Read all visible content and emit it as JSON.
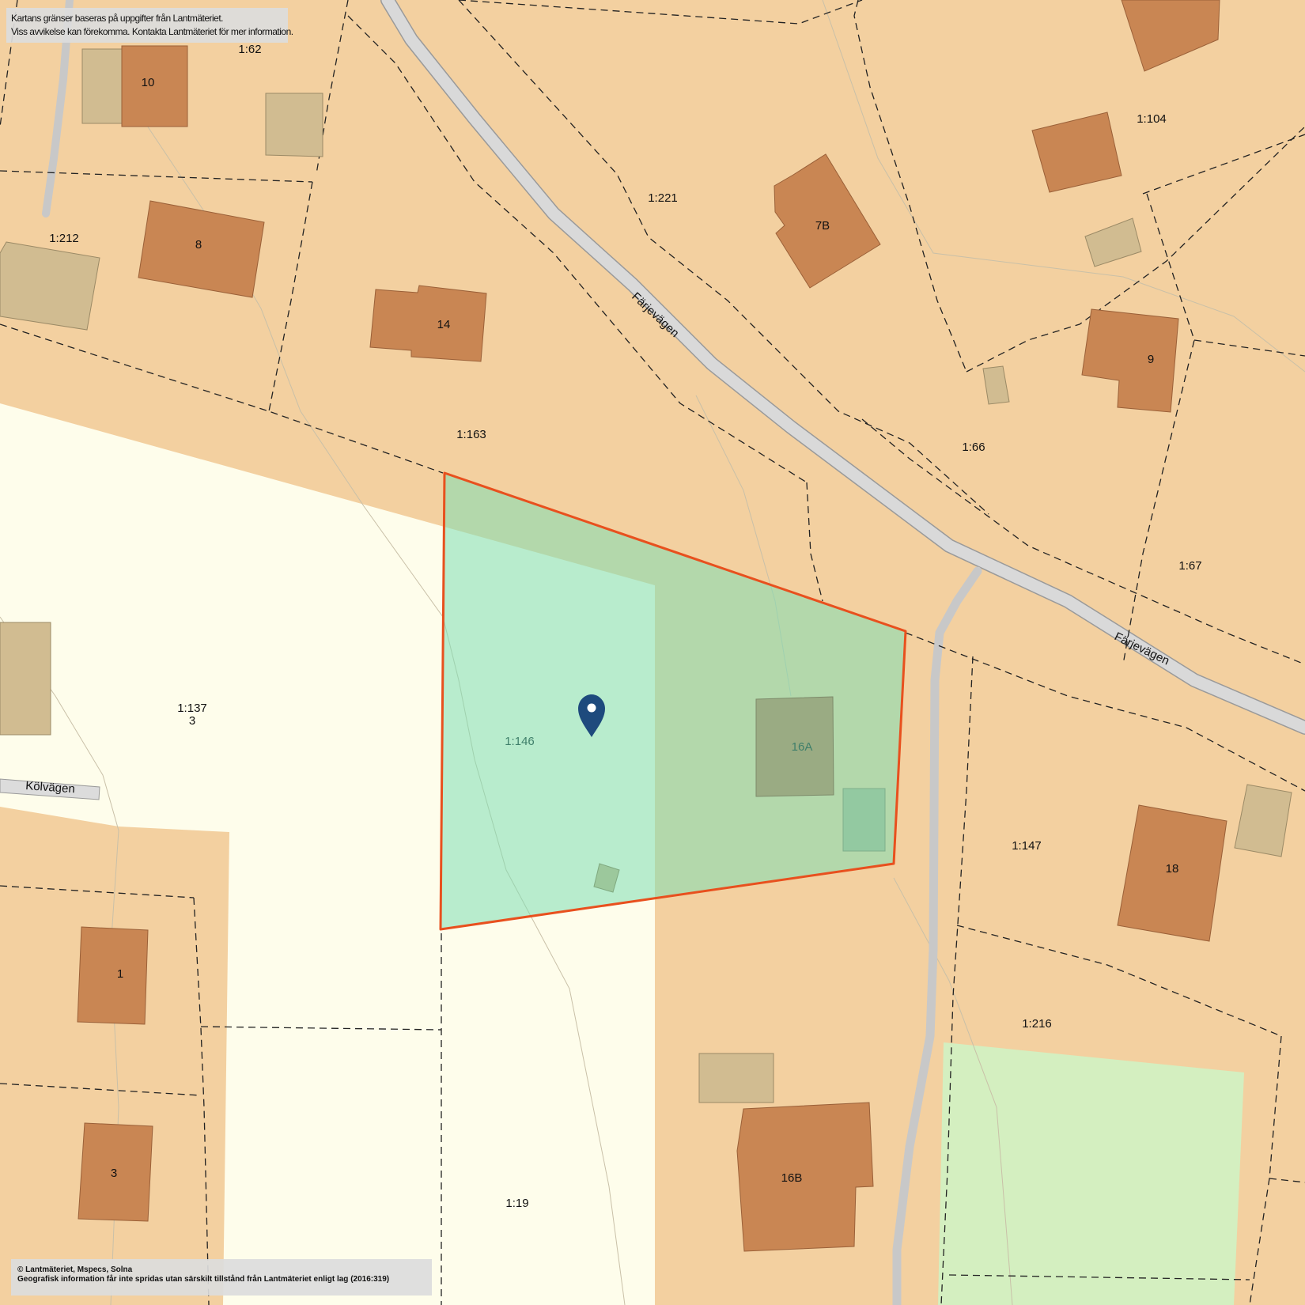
{
  "map": {
    "colors": {
      "residential": "#f3d0a0",
      "open_land": "#fefdeb",
      "building": "#c98653",
      "outbuilding": "#d1bc91",
      "selection_fill": "#7edfb4",
      "selection_border": "#e8501e",
      "park": "#d4efc0",
      "road": "#d4d4d4",
      "marker": "#1e4a7d"
    },
    "plots": [
      {
        "id": "1:62",
        "label": "1:62"
      },
      {
        "id": "1:104",
        "label": "1:104"
      },
      {
        "id": "1:221",
        "label": "1:221"
      },
      {
        "id": "1:212",
        "label": "1:212"
      },
      {
        "id": "1:163",
        "label": "1:163"
      },
      {
        "id": "1:66",
        "label": "1:66"
      },
      {
        "id": "1:67",
        "label": "1:67"
      },
      {
        "id": "1:137",
        "label": "1:137",
        "sub_label": "3"
      },
      {
        "id": "1:146",
        "label": "1:146"
      },
      {
        "id": "1:147",
        "label": "1:147"
      },
      {
        "id": "1:216",
        "label": "1:216"
      },
      {
        "id": "1:19",
        "label": "1:19"
      }
    ],
    "buildings": [
      {
        "id": "10",
        "label": "10"
      },
      {
        "id": "8",
        "label": "8"
      },
      {
        "id": "14",
        "label": "14"
      },
      {
        "id": "7B",
        "label": "7B"
      },
      {
        "id": "9",
        "label": "9"
      },
      {
        "id": "16A",
        "label": "16A"
      },
      {
        "id": "18",
        "label": "18"
      },
      {
        "id": "1",
        "label": "1"
      },
      {
        "id": "3",
        "label": "3"
      },
      {
        "id": "16B",
        "label": "16B"
      }
    ],
    "roads": {
      "farjevagen_1": "Färjevägen",
      "farjevagen_2": "Färjevägen",
      "kolvagen": "Kölvägen"
    },
    "selected_plot": "1:146",
    "marker_icon": "location-pin-icon"
  },
  "notices": {
    "top_line_1": "Kartans gränser baseras på uppgifter från Lantmäteriet.",
    "top_line_2": "Viss avvikelse kan förekomma. Kontakta Lantmäteriet för mer information.",
    "bottom_line_1": "© Lantmäteriet, Mspecs, Solna",
    "bottom_line_2": "Geografisk information får inte spridas utan särskilt tillstånd från Lantmäteriet enligt lag (2016:319)"
  }
}
